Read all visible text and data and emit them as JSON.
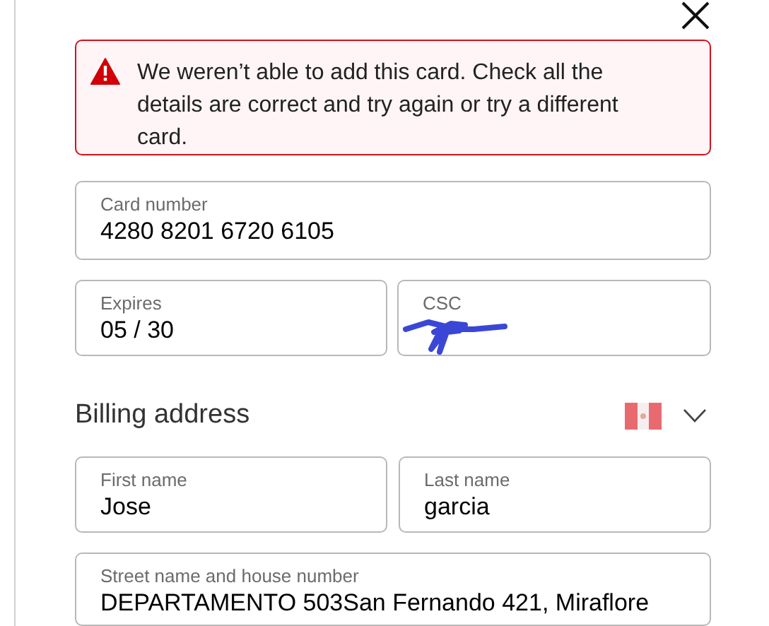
{
  "error_message": "We weren’t able to add this card. Check all the details are correct and try again or try a different card.",
  "card_number": {
    "label": "Card number",
    "value": "4280 8201 6720 6105"
  },
  "expires": {
    "label": "Expires",
    "value": "05 / 30"
  },
  "csc": {
    "label": "CSC",
    "redacted": true
  },
  "billing_address": {
    "title": "Billing address",
    "expanded": false
  },
  "first_name": {
    "label": "First name",
    "value": "Jose"
  },
  "last_name": {
    "label": "Last name",
    "value": "garcia"
  },
  "street": {
    "label": "Street name and house number",
    "value": "DEPARTAMENTO 503San Fernando 421, Miraflore"
  }
}
